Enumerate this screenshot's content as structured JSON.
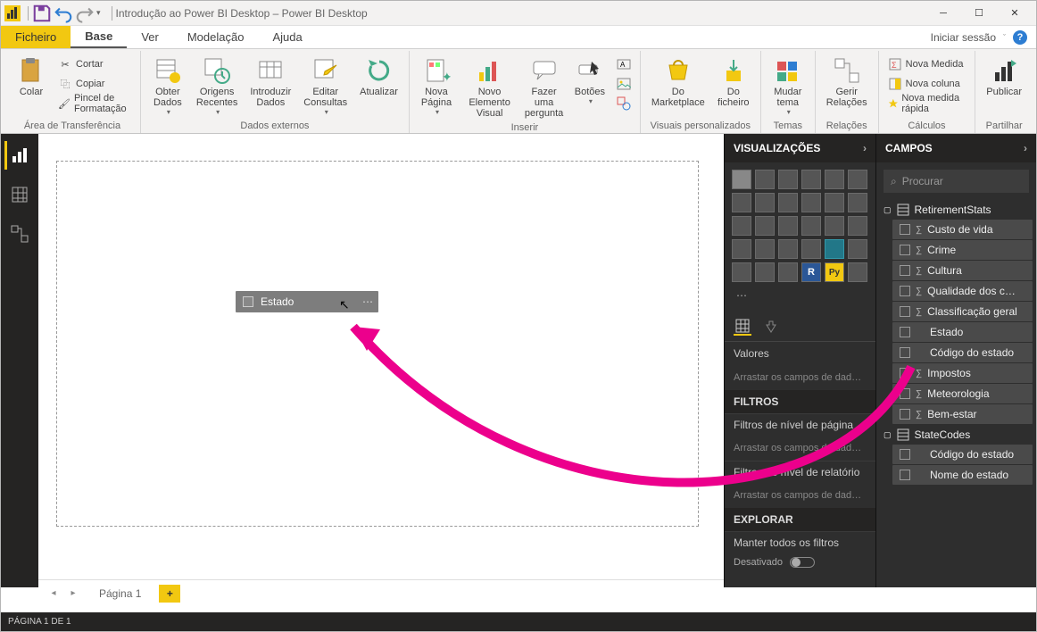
{
  "titlebar": {
    "title": "Introdução ao Power BI Desktop – Power BI Desktop"
  },
  "menu": {
    "file": "Ficheiro",
    "tabs": [
      "Base",
      "Ver",
      "Modelação",
      "Ajuda"
    ],
    "signin": "Iniciar sessão"
  },
  "ribbon": {
    "clipboard": {
      "paste": "Colar",
      "cut": "Cortar",
      "copy": "Copiar",
      "format_painter": "Pincel de Formatação",
      "group_label": "Área de Transferência"
    },
    "external": {
      "get_data": "Obter\nDados",
      "recent": "Origens\nRecentes",
      "enter_data": "Introduzir\nDados",
      "edit_queries": "Editar\nConsultas",
      "refresh": "Atualizar",
      "group_label": "Dados externos"
    },
    "insert": {
      "new_page": "Nova\nPágina",
      "new_visual": "Novo Elemento\nVisual",
      "question": "Fazer uma\npergunta",
      "buttons": "Botões",
      "group_label": "Inserir"
    },
    "custom": {
      "marketplace": "Do\nMarketplace",
      "from_file": "Do\nficheiro",
      "group_label": "Visuais personalizados"
    },
    "themes": {
      "switch_theme": "Mudar\ntema",
      "group_label": "Temas"
    },
    "relations": {
      "manage": "Gerir\nRelações",
      "group_label": "Relações"
    },
    "calc": {
      "new_measure": "Nova Medida",
      "new_column": "Nova coluna",
      "quick_measure": "Nova medida rápida",
      "group_label": "Cálculos"
    },
    "share": {
      "publish": "Publicar",
      "group_label": "Partilhar"
    }
  },
  "canvas": {
    "drag_field": "Estado"
  },
  "vis_pane": {
    "title": "VISUALIZAÇÕES",
    "values_label": "Valores",
    "drop_fields": "Arrastar os campos de dad…",
    "filters_title": "FILTROS",
    "page_filters": "Filtros de nível de página",
    "report_filters": "Filtros de nível de relatório",
    "explore_title": "EXPLORAR",
    "keep_filters": "Manter todos os filtros",
    "disabled": "Desativado"
  },
  "fields_pane": {
    "title": "CAMPOS",
    "search_placeholder": "Procurar",
    "tables": [
      {
        "name": "RetirementStats",
        "fields": [
          {
            "name": "Custo de vida",
            "sigma": true
          },
          {
            "name": "Crime",
            "sigma": true
          },
          {
            "name": "Cultura",
            "sigma": true
          },
          {
            "name": "Qualidade dos c…",
            "sigma": true
          },
          {
            "name": "Classificação geral",
            "sigma": true
          },
          {
            "name": "Estado",
            "sigma": false
          },
          {
            "name": "Código do estado",
            "sigma": false
          },
          {
            "name": "Impostos",
            "sigma": true
          },
          {
            "name": "Meteorologia",
            "sigma": true
          },
          {
            "name": "Bem-estar",
            "sigma": true
          }
        ]
      },
      {
        "name": "StateCodes",
        "fields": [
          {
            "name": "Código do estado",
            "sigma": false
          },
          {
            "name": "Nome do estado",
            "sigma": false
          }
        ]
      }
    ]
  },
  "pages": {
    "page1": "Página 1"
  },
  "status": {
    "text": "PÁGINA 1 DE 1"
  }
}
